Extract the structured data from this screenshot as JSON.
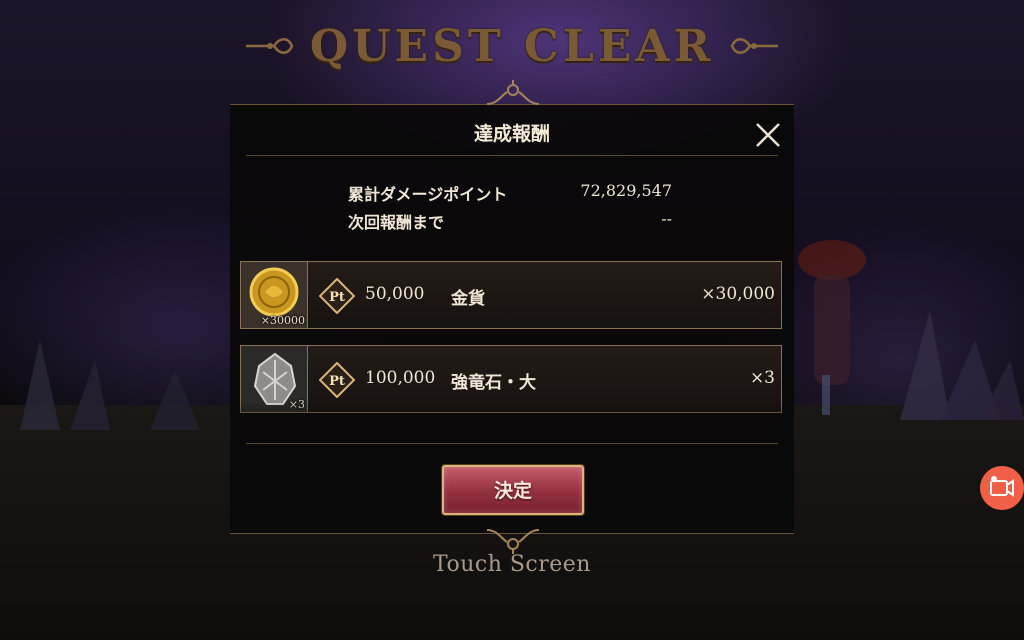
{
  "banner": {
    "title": "QUEST CLEAR"
  },
  "dialog": {
    "title": "達成報酬",
    "stats": [
      {
        "label": "累計ダメージポイント",
        "value": "72,829,547"
      },
      {
        "label": "次回報酬まで",
        "value": "--"
      }
    ],
    "rewards": [
      {
        "icon": "gold-coin-icon",
        "icon_qty": "×30000",
        "points": "50,000",
        "name": "金貨",
        "count": "×30,000"
      },
      {
        "icon": "dragon-stone-icon",
        "icon_qty": "×3",
        "points": "100,000",
        "name": "強竜石・大",
        "count": "×3"
      }
    ],
    "pt_badge_label": "Pt",
    "confirm_label": "決定",
    "close_icon": "close-icon"
  },
  "footer": {
    "touch_prompt": "Touch Screen"
  },
  "overlay": {
    "record_icon": "screen-record-icon"
  },
  "colors": {
    "accent_gold": "#d9b57a",
    "confirm_red": "#93303f",
    "record_orange": "#f06048"
  }
}
